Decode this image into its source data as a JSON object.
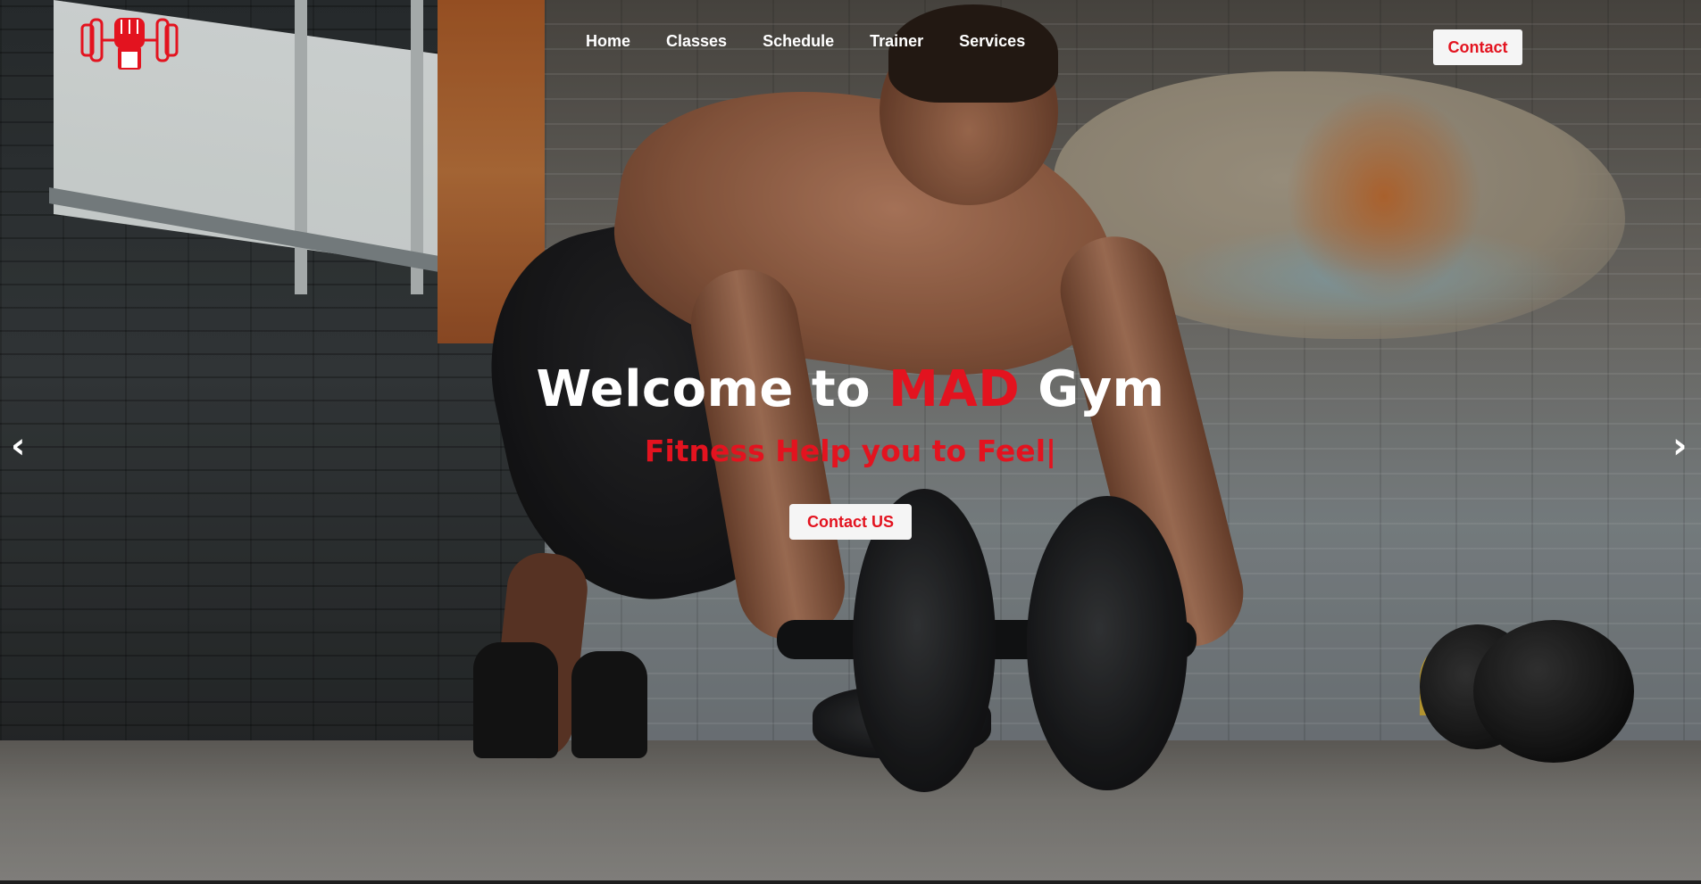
{
  "brand": {
    "logo_icon": "fist-dumbbell-icon",
    "accent_color": "#e3131f"
  },
  "nav": {
    "items": [
      {
        "label": "Home"
      },
      {
        "label": "Classes"
      },
      {
        "label": "Schedule"
      },
      {
        "label": "Trainer"
      },
      {
        "label": "Services"
      }
    ],
    "contact_label": "Contact"
  },
  "hero": {
    "title_prefix": "Welcome to ",
    "title_accent": "MAD",
    "title_suffix": " Gym",
    "subtitle": "Fitness Help you to Feel|",
    "cta_label": "Contact US",
    "prev_arrow": "‹",
    "next_arrow": "›"
  }
}
